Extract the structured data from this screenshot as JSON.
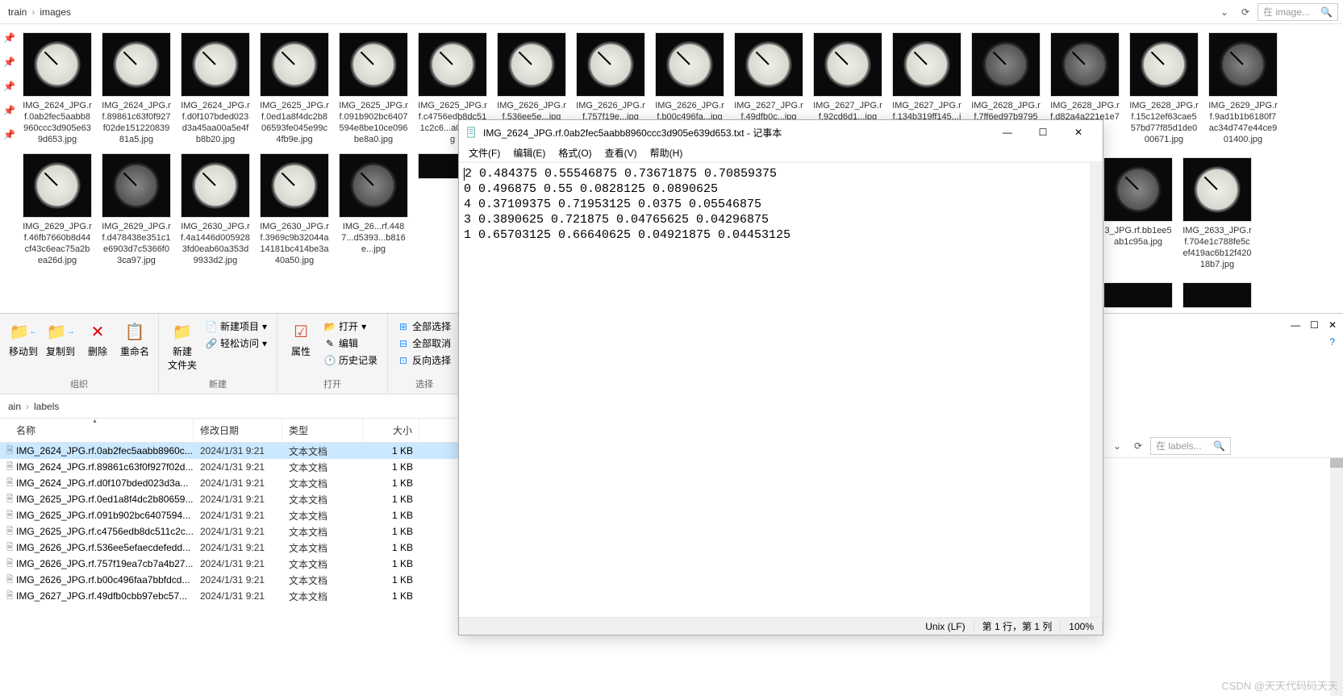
{
  "breadcrumb_top": {
    "root": "train",
    "sub": "images",
    "search_placeholder": "在 image... "
  },
  "breadcrumb_bot": {
    "root": "ain",
    "sub": "labels",
    "search_placeholder": "在 labels... "
  },
  "ribbon": {
    "group_org": "组织",
    "move_to": "移动到",
    "copy_to": "复制到",
    "delete": "删除",
    "rename": "重命名",
    "group_new": "新建",
    "new_folder": "新建\n文件夹",
    "new_item": "新建项目",
    "easy_access": "轻松访问",
    "group_open": "打开",
    "properties": "属性",
    "open": "打开",
    "edit": "编辑",
    "history": "历史记录",
    "group_select": "选择",
    "select_all": "全部选择",
    "select_none": "全部取消",
    "invert": "反向选择"
  },
  "thumbs": [
    {
      "name": "IMG_2624_JPG.rf.0ab2fec5aabb8960ccc3d905e639d653.jpg",
      "dark": false
    },
    {
      "name": "IMG_2624_JPG.rf.89861c63f0f927f02de15122083981a5.jpg",
      "dark": false
    },
    {
      "name": "IMG_2624_JPG.rf.d0f107bded023d3a45aa00a5e4fb8b20.jpg",
      "dark": false
    },
    {
      "name": "IMG_2625_JPG.rf.0ed1a8f4dc2b806593fe045e99c4fb9e.jpg",
      "dark": false
    },
    {
      "name": "IMG_2625_JPG.rf.091b902bc6407594e8be10ce096be8a0.jpg",
      "dark": false
    },
    {
      "name": "IMG_2625_JPG.rf.c4756edb8dc511c2c6...a033...jpg",
      "dark": false
    },
    {
      "name": "IMG_2626_JPG.rf.536ee5e...jpg",
      "dark": false
    },
    {
      "name": "IMG_2626_JPG.rf.757f19e...jpg",
      "dark": false
    },
    {
      "name": "IMG_2626_JPG.rf.b00c496fa...jpg",
      "dark": false
    },
    {
      "name": "IMG_2627_JPG.rf.49dfb0c...jpg",
      "dark": false
    },
    {
      "name": "IMG_2627_JPG.rf.92cd6d1...jpg",
      "dark": false
    },
    {
      "name": "IMG_2627_JPG.rf.134b319ff145...jpg",
      "dark": false
    },
    {
      "name": "IMG_2628_JPG.rf.7ff6ed97b97959...jpg",
      "dark": true
    },
    {
      "name": "IMG_2628_JPG.rf.d82a4a221e1e73.jpg",
      "dark": true
    },
    {
      "name": "IMG_2628_JPG.rf.15c12ef63cae557bd77f85d1de000671.jpg",
      "dark": false
    },
    {
      "name": "IMG_2629_JPG.rf.9ad1b1b6180f7ac34d747e44ce901400.jpg",
      "dark": true
    },
    {
      "name": "IMG_2629_JPG.rf.46fb7660b8d44cf43c6eac75a2bea26d.jpg",
      "dark": false
    },
    {
      "name": "IMG_2629_JPG.rf.d478438e351c1e6903d7c5366f03ca97.jpg",
      "dark": true
    },
    {
      "name": "IMG_2630_JPG.rf.4a1446d0059283fd0eab60a353d9933d2.jpg",
      "dark": false
    },
    {
      "name": "IMG_2630_JPG.rf.3969c9b32044a14181bc414be3a40a50.jpg",
      "dark": false
    },
    {
      "name": "IMG_26...rf.4487...d5393...b816e...jpg",
      "dark": true
    }
  ],
  "thumbs_partial_row2_tail": [
    {
      "name": "3_JPG.rf.bb1ee5ab1c95a.jpg",
      "dark": true
    },
    {
      "name": "IMG_2633_JPG.rf.704e1c788fe5cef419ac6b12f42018b7.jpg",
      "dark": false
    }
  ],
  "file_headers": {
    "name": "名称",
    "date": "修改日期",
    "type": "类型",
    "size": "大小"
  },
  "files": [
    {
      "name": "IMG_2624_JPG.rf.0ab2fec5aabb8960c...",
      "date": "2024/1/31 9:21",
      "type": "文本文档",
      "size": "1 KB",
      "selected": true
    },
    {
      "name": "IMG_2624_JPG.rf.89861c63f0f927f02d...",
      "date": "2024/1/31 9:21",
      "type": "文本文档",
      "size": "1 KB"
    },
    {
      "name": "IMG_2624_JPG.rf.d0f107bded023d3a...",
      "date": "2024/1/31 9:21",
      "type": "文本文档",
      "size": "1 KB"
    },
    {
      "name": "IMG_2625_JPG.rf.0ed1a8f4dc2b80659...",
      "date": "2024/1/31 9:21",
      "type": "文本文档",
      "size": "1 KB"
    },
    {
      "name": "IMG_2625_JPG.rf.091b902bc6407594...",
      "date": "2024/1/31 9:21",
      "type": "文本文档",
      "size": "1 KB"
    },
    {
      "name": "IMG_2625_JPG.rf.c4756edb8dc511c2c...",
      "date": "2024/1/31 9:21",
      "type": "文本文档",
      "size": "1 KB"
    },
    {
      "name": "IMG_2626_JPG.rf.536ee5efaecdefedd...",
      "date": "2024/1/31 9:21",
      "type": "文本文档",
      "size": "1 KB"
    },
    {
      "name": "IMG_2626_JPG.rf.757f19ea7cb7a4b27...",
      "date": "2024/1/31 9:21",
      "type": "文本文档",
      "size": "1 KB"
    },
    {
      "name": "IMG_2626_JPG.rf.b00c496faa7bbfdcd...",
      "date": "2024/1/31 9:21",
      "type": "文本文档",
      "size": "1 KB"
    },
    {
      "name": "IMG_2627_JPG.rf.49dfb0cbb97ebc57...",
      "date": "2024/1/31 9:21",
      "type": "文本文档",
      "size": "1 KB"
    }
  ],
  "notepad": {
    "title": "IMG_2624_JPG.rf.0ab2fec5aabb8960ccc3d905e639d653.txt - 记事本",
    "menu": {
      "file": "文件(F)",
      "edit": "编辑(E)",
      "format": "格式(O)",
      "view": "查看(V)",
      "help": "帮助(H)"
    },
    "lines": [
      "2 0.484375 0.55546875 0.73671875 0.70859375",
      "0 0.496875 0.55 0.0828125 0.0890625",
      "4 0.37109375 0.71953125 0.0375 0.05546875",
      "3 0.3890625 0.721875 0.04765625 0.04296875",
      "1 0.65703125 0.66640625 0.04921875 0.04453125"
    ],
    "status": {
      "eol": "Unix (LF)",
      "pos": "第 1 行，第 1 列",
      "zoom": "100%"
    }
  },
  "watermark": "CSDN @天天代码码天天"
}
